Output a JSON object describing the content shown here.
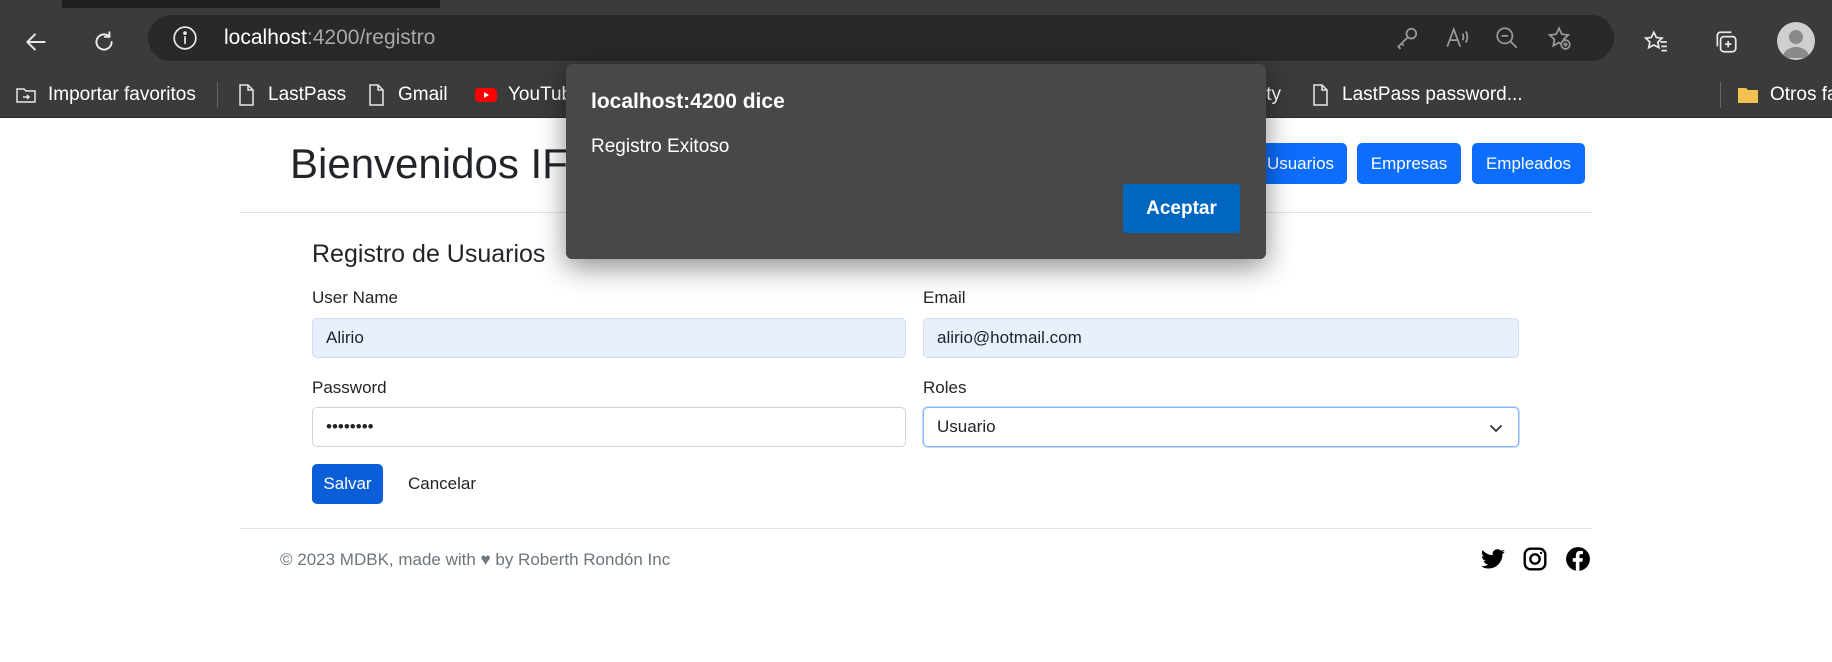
{
  "browser": {
    "url_host": "localhost",
    "url_rest": ":4200/registro",
    "bookmarks": [
      {
        "label": "Importar favoritos",
        "icon": "import-icon"
      },
      {
        "label": "LastPass",
        "icon": "page-icon"
      },
      {
        "label": "Gmail",
        "icon": "page-icon"
      },
      {
        "label": "YouTube",
        "icon": "youtube-icon"
      },
      {
        "label": "ity",
        "icon": "page-icon"
      },
      {
        "label": "LastPass password...",
        "icon": "page-icon"
      },
      {
        "label": "Otros fa",
        "icon": "folder-icon"
      }
    ]
  },
  "header": {
    "title": "Bienvenidos IF",
    "nav": [
      "Usuarios",
      "Empresas",
      "Empleados"
    ],
    "nav_color": "#0d6efd"
  },
  "form": {
    "title": "Registro de Usuarios",
    "username_label": "User Name",
    "username_value": "Alirio",
    "email_label": "Email",
    "email_value": "alirio@hotmail.com",
    "password_label": "Password",
    "password_value": "••••••••",
    "roles_label": "Roles",
    "roles_value": "Usuario",
    "save_label": "Salvar",
    "cancel_label": "Cancelar"
  },
  "footer": {
    "text": "© 2023 MDBK, made with ♥ by Roberth Rondón Inc",
    "social": [
      "twitter-icon",
      "instagram-icon",
      "facebook-icon"
    ]
  },
  "dialog": {
    "title": "localhost:4200 dice",
    "message": "Registro Exitoso",
    "ok_label": "Aceptar"
  }
}
